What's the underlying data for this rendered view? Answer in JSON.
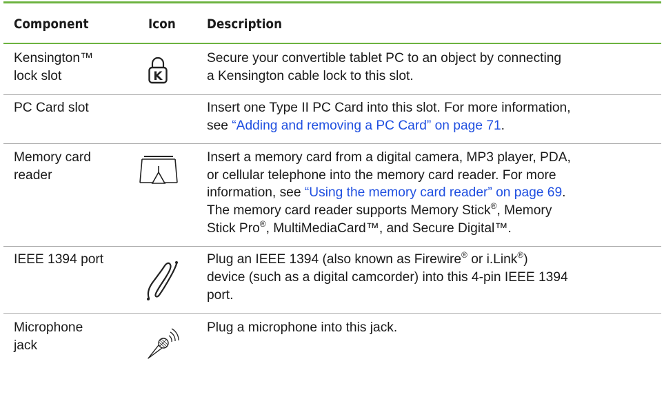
{
  "table": {
    "headers": {
      "component": "Component",
      "icon": "Icon",
      "description": "Description"
    },
    "rows": [
      {
        "component_lines": [
          "Kensington™",
          "lock slot"
        ],
        "icon": "kensington-lock-icon",
        "description": {
          "line1": "Secure your convertible tablet PC to an object by connecting",
          "line2": "a Kensington cable lock to this slot."
        }
      },
      {
        "component_lines": [
          "PC Card slot"
        ],
        "icon": "",
        "description": {
          "line1": "Insert one Type II PC Card into this slot. For more information,",
          "line2_prefix": "see ",
          "line2_link": "“Adding and removing a PC Card” on page 71",
          "line2_suffix": "."
        }
      },
      {
        "component_lines": [
          "Memory card",
          "reader"
        ],
        "icon": "memory-card-reader-icon",
        "description": {
          "line1": "Insert a memory card from a digital camera, MP3 player, PDA,",
          "line2": "or cellular telephone into the memory card reader. For more",
          "line3_prefix": "information, see ",
          "line3_link": "“Using the memory card reader” on page 69",
          "line3_suffix": ".",
          "line4_a": "The memory card reader supports Memory Stick",
          "line4_reg": "®",
          "line4_b": ", Memory",
          "line5_a": "Stick Pro",
          "line5_reg": "®",
          "line5_b": ", MultiMediaCard™, and Secure Digital™."
        }
      },
      {
        "component_lines": [
          "IEEE 1394 port"
        ],
        "icon": "ieee-1394-icon",
        "description": {
          "line1_a": "Plug an IEEE 1394 (also known as Firewire",
          "line1_reg1": "®",
          "line1_b": " or i.Link",
          "line1_reg2": "®",
          "line1_c": ")",
          "line2": "device (such as a digital camcorder) into this 4-pin IEEE 1394",
          "line3": "port."
        }
      },
      {
        "component_lines": [
          "Microphone",
          "jack"
        ],
        "icon": "microphone-icon",
        "description": {
          "line1": "Plug a microphone into this jack."
        }
      }
    ]
  }
}
